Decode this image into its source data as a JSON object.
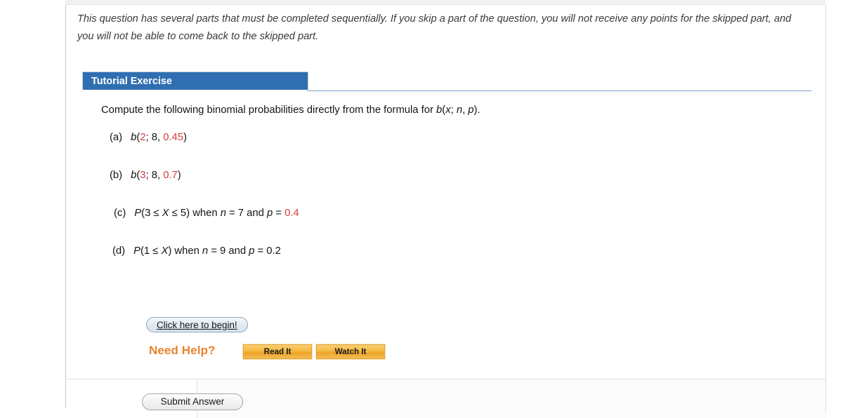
{
  "intro": {
    "text": "This question has several parts that must be completed sequentially. If you skip a part of the question, you will not receive any points for the skipped part, and you will not be able to come back to the skipped part."
  },
  "exercise": {
    "header_label": "Tutorial Exercise",
    "stem_prefix": "Compute the following binomial probabilities directly from the formula for ",
    "stem_formula_b": "b",
    "stem_formula_open": "(",
    "stem_formula_x": "x",
    "stem_formula_semi": "; ",
    "stem_formula_n": "n",
    "stem_formula_comma": ", ",
    "stem_formula_p": "p",
    "stem_formula_close": ").",
    "parts": [
      {
        "label": "(a)",
        "func": "b",
        "open": "(",
        "x": "2",
        "sep1": "; ",
        "n": "8",
        "sep2": ", ",
        "p": "0.45",
        "close": ")",
        "x_color": "red",
        "p_color": "red"
      },
      {
        "label": "(b)",
        "func": "b",
        "open": "(",
        "x": "3",
        "sep1": "; ",
        "n": "8",
        "sep2": ", ",
        "p": "0.7",
        "close": ")",
        "x_color": "red",
        "p_color": "red"
      },
      {
        "label": "(c)",
        "prob": "P",
        "expr_open": "(3 ",
        "le1": "≤",
        "rv": "X",
        "le2": "≤",
        "upper": "5)",
        "when": " when ",
        "n_var": "n",
        "n_eq": " = 7 and ",
        "p_var": "p",
        "p_eq": " = ",
        "p_val": "0.4",
        "p_color": "red"
      },
      {
        "label": "(d)",
        "prob": "P",
        "expr_open": "(1 ",
        "le1": "≤",
        "rv": "X",
        "upper": ")",
        "when": " when ",
        "n_var": "n",
        "n_eq": " = 9 and ",
        "p_var": "p",
        "p_eq": " = ",
        "p_val": "0.2",
        "p_color": "black"
      }
    ]
  },
  "actions": {
    "begin_label": "Click here to begin!",
    "need_help_label": "Need Help?",
    "read_it_label": "Read It",
    "watch_it_label": "Watch It",
    "submit_label": "Submit Answer"
  },
  "colors": {
    "tab_blue": "#2f6eb0",
    "rule_blue": "#7ba2c9",
    "accent_red": "#d93b3b",
    "help_orange": "#e8842c",
    "button_orange": "#f5b942"
  }
}
